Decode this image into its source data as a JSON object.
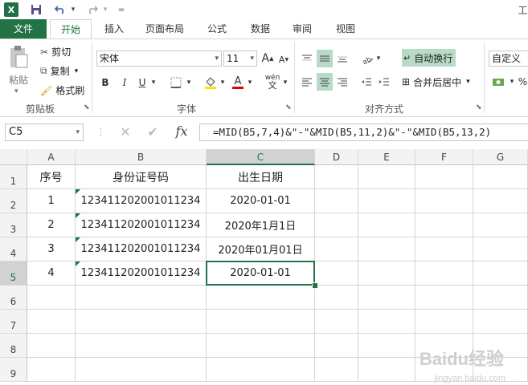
{
  "quick_access": {
    "undo_arrow": "▾",
    "redo_arrow": "▾",
    "customize": "=",
    "right_char": "工"
  },
  "tabs": [
    "文件",
    "开始",
    "插入",
    "页面布局",
    "公式",
    "数据",
    "审阅",
    "视图"
  ],
  "clipboard": {
    "paste": "粘贴",
    "cut": "剪切",
    "copy": "复制",
    "format_painter": "格式刷",
    "group": "剪贴板"
  },
  "font": {
    "name": "宋体",
    "size": "11",
    "bold": "B",
    "italic": "I",
    "underline": "U",
    "grow": "A",
    "shrink": "A",
    "wen": "wén",
    "group": "字体"
  },
  "alignment": {
    "wrap_text": "自动换行",
    "merge_center": "合并后居中",
    "group": "对齐方式"
  },
  "number": {
    "format": "自定义"
  },
  "formula_bar": {
    "name_box": "C5",
    "formula": "=MID(B5,7,4)&\"-\"&MID(B5,11,2)&\"-\"&MID(B5,13,2)"
  },
  "grid": {
    "columns": [
      "A",
      "B",
      "C",
      "D",
      "E",
      "F",
      "G"
    ],
    "rows": [
      "1",
      "2",
      "3",
      "4",
      "5",
      "6",
      "7",
      "8",
      "9"
    ],
    "header_row": [
      "序号",
      "身份证号码",
      "出生日期"
    ],
    "data": [
      [
        "1",
        "123411202001011234",
        "2020-01-01"
      ],
      [
        "2",
        "123411202001011234",
        "2020年1月1日"
      ],
      [
        "3",
        "123411202001011234",
        "2020年01月01日"
      ],
      [
        "4",
        "123411202001011234",
        "2020-01-01"
      ]
    ],
    "selected_cell": "C5",
    "accent": "#217346"
  },
  "watermark": {
    "logo": "Baidu经验",
    "url": "jingyan.baidu.com"
  }
}
